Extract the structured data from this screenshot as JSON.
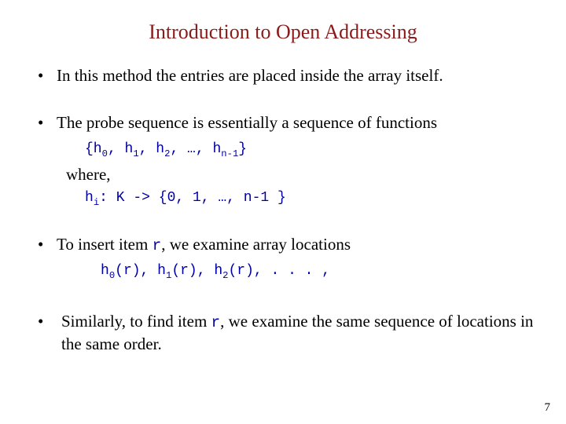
{
  "title": "Introduction to Open Addressing",
  "bullets": {
    "b1": "In this method the entries are placed inside the array itself.",
    "b2": "The probe sequence is essentially a sequence of functions",
    "b3_pre": "To insert item ",
    "b3_r": "r",
    "b3_post": ", we examine array locations",
    "b4_pre": "Similarly, to find item ",
    "b4_r": "r",
    "b4_post": ", we examine the same sequence of locations in the same order."
  },
  "code": {
    "seq_open": "{h",
    "s0": "0",
    "seq_c1": ", h",
    "s1": "1",
    "seq_c2": ", h",
    "s2": "2",
    "seq_c3": ", …, h",
    "snm1": "n-1",
    "seq_close": "}",
    "where": "where,",
    "hi_h": "h",
    "hi_i": "i",
    "hi_rest": ": K -> {0, 1, …, n-1 }",
    "ins_h0": "h",
    "ins_0": "0",
    "ins_r0": "(r), h",
    "ins_1": "1",
    "ins_r1": "(r), h",
    "ins_2": "2",
    "ins_r2": "(r), . . . ,"
  },
  "pagenum": "7"
}
